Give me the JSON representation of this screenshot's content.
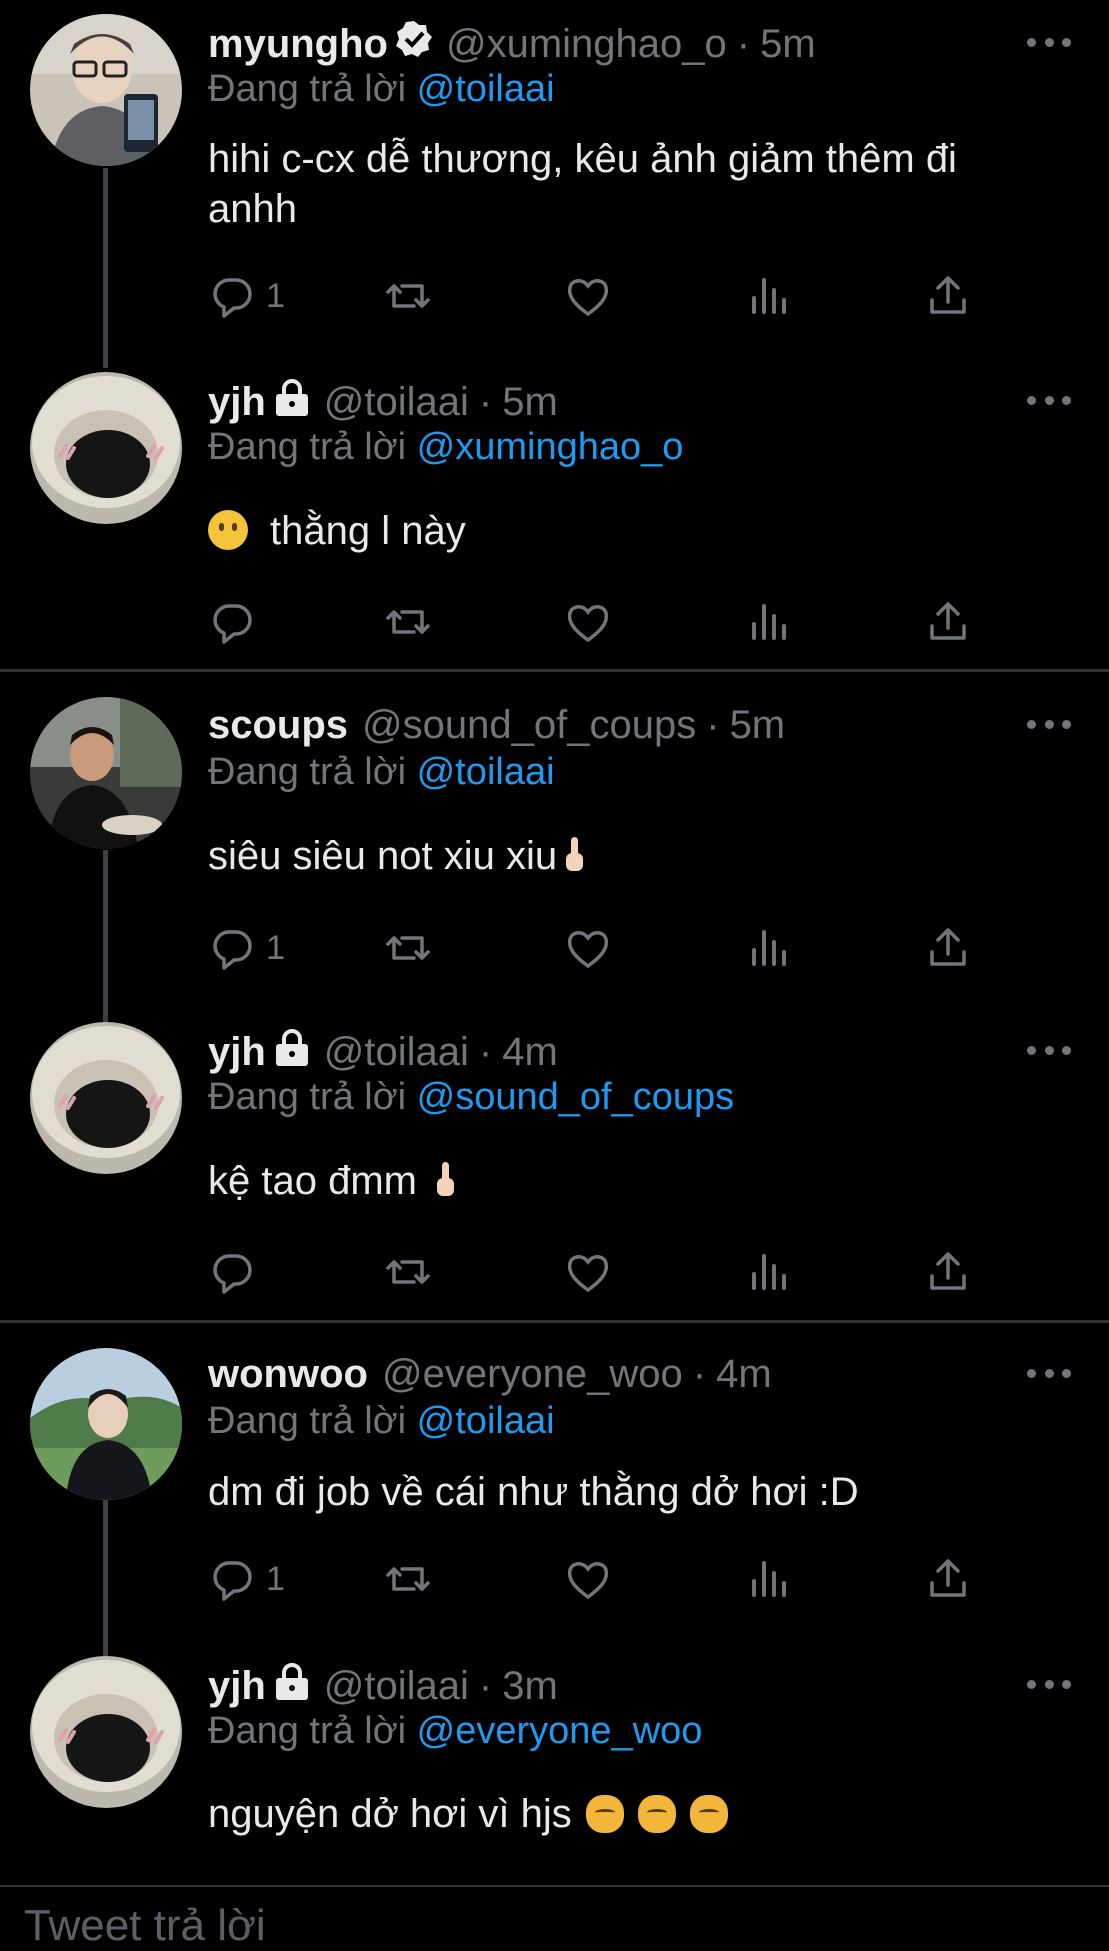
{
  "reply_prefix": "Đang trả lời",
  "tweets": [
    {
      "name": "myungho",
      "handle": "@xuminghao_o",
      "time": "5m",
      "reply_to": "@toilaai",
      "text": "hihi c-cx dễ thương, kêu ảnh giảm thêm đi anhh",
      "replies": "1",
      "verified": true
    },
    {
      "name": "yjh",
      "handle": "@toilaai",
      "time": "5m",
      "reply_to": "@xuminghao_o",
      "text": "thằng l này",
      "replies": "",
      "locked": true
    },
    {
      "name": "scoups",
      "handle": "@sound_of_coups",
      "time": "5m",
      "reply_to": "@toilaai",
      "text": "siêu siêu not xiu xiu",
      "replies": "1"
    },
    {
      "name": "yjh",
      "handle": "@toilaai",
      "time": "4m",
      "reply_to": "@sound_of_coups",
      "text": "kệ tao đmm",
      "replies": "",
      "locked": true
    },
    {
      "name": "wonwoo",
      "handle": "@everyone_woo",
      "time": "4m",
      "reply_to": "@toilaai",
      "text": "dm đi job về cái như thằng dở hơi :D",
      "replies": "1"
    },
    {
      "name": "yjh",
      "handle": "@toilaai",
      "time": "3m",
      "reply_to": "@everyone_woo",
      "text": "nguyện dở hơi vì hjs",
      "replies": "",
      "locked": true
    }
  ],
  "compose_placeholder": "Tweet trả lời",
  "icons": {
    "reply": "reply-icon",
    "retweet": "retweet-icon",
    "like": "heart-icon",
    "views": "views-icon",
    "share": "share-icon",
    "more": "more-icon",
    "verified": "verified-badge-icon",
    "lock": "lock-icon"
  }
}
